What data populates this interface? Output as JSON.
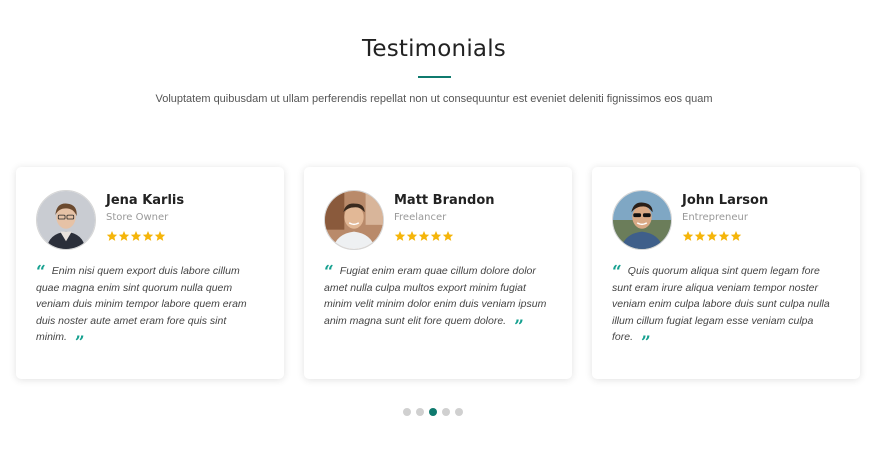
{
  "section": {
    "title": "Testimonials",
    "subtitle": "Voluptatem quibusdam ut ullam perferendis repellat non ut consequuntur est eveniet deleniti fignissimos eos quam"
  },
  "testimonials": [
    {
      "name": "Jena Karlis",
      "role": "Store Owner",
      "rating": 5,
      "quote": "Enim nisi quem export duis labore cillum quae magna enim sint quorum nulla quem veniam duis minim tempor labore quem eram duis noster aute amet eram fore quis sint minim."
    },
    {
      "name": "Matt Brandon",
      "role": "Freelancer",
      "rating": 5,
      "quote": "Fugiat enim eram quae cillum dolore dolor amet nulla culpa multos export minim fugiat minim velit minim dolor enim duis veniam ipsum anim magna sunt elit fore quem dolore."
    },
    {
      "name": "John Larson",
      "role": "Entrepreneur",
      "rating": 5,
      "quote": "Quis quorum aliqua sint quem legam fore sunt eram irure aliqua veniam tempor noster veniam enim culpa labore duis sunt culpa nulla illum cillum fugiat legam esse veniam culpa fore."
    }
  ],
  "carousel": {
    "pages": 5,
    "active": 2
  },
  "colors": {
    "accent": "#0f7a6e",
    "star": "#f5b50a",
    "quote_mark": "#14a08f"
  }
}
